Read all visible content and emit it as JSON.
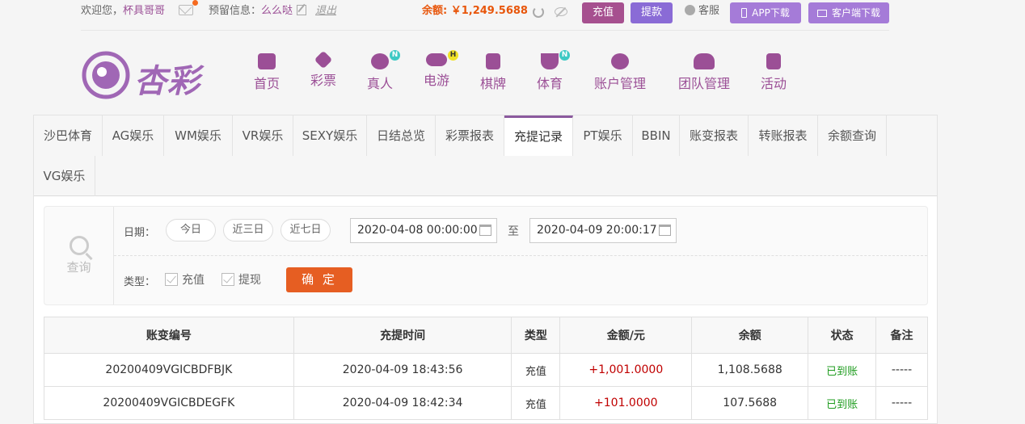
{
  "topbar": {
    "welcome_prefix": "欢迎您，",
    "username": "杯具哥哥",
    "reserve_label": "预留信息：",
    "reserve_value": "么么哒",
    "logout": "退出",
    "balance_label": "余额: ￥1,249.5688",
    "recharge": "充值",
    "withdraw": "提款",
    "service": "客服",
    "app_download": "APP下载",
    "client_download": "客户端下载"
  },
  "logo": {
    "text": "杏彩"
  },
  "nav": [
    {
      "label": "首页",
      "icon": "home-icon"
    },
    {
      "label": "彩票",
      "icon": "lottery-icon"
    },
    {
      "label": "真人",
      "icon": "live-dealer-icon",
      "badge": "N"
    },
    {
      "label": "电游",
      "icon": "gamepad-icon",
      "badge": "H"
    },
    {
      "label": "棋牌",
      "icon": "cards-icon"
    },
    {
      "label": "体育",
      "icon": "trophy-icon",
      "badge": "N"
    },
    {
      "label": "账户管理",
      "icon": "yen-icon"
    },
    {
      "label": "团队管理",
      "icon": "team-icon"
    },
    {
      "label": "活动",
      "icon": "gift-icon"
    }
  ],
  "tabs": [
    "沙巴体育",
    "AG娱乐",
    "WM娱乐",
    "VR娱乐",
    "SEXY娱乐",
    "日结总览",
    "彩票报表",
    "充提记录",
    "PT娱乐",
    "BBIN",
    "账变报表",
    "转账报表",
    "余额查询",
    "VG娱乐"
  ],
  "filter": {
    "query_label": "查询",
    "date_label": "日期：",
    "quick_ranges": [
      "今日",
      "近三日",
      "近七日"
    ],
    "start_date": "2020-04-08 00:00:00",
    "to_label": "至",
    "end_date": "2020-04-09 20:00:17",
    "type_label": "类型：",
    "type_recharge": "充值",
    "type_withdraw": "提现",
    "confirm": "确 定"
  },
  "table": {
    "headers": [
      "账变编号",
      "充提时间",
      "类型",
      "金额/元",
      "余额",
      "状态",
      "备注"
    ],
    "rows": [
      [
        "20200409VGICBDFBJK",
        "2020-04-09 18:43:56",
        "充值",
        "+1,001.0000",
        "1,108.5688",
        "已到账",
        "-----"
      ],
      [
        "20200409VGICBDEGFK",
        "2020-04-09 18:42:34",
        "充值",
        "+101.0000",
        "107.5688",
        "已到账",
        "-----"
      ]
    ]
  }
}
